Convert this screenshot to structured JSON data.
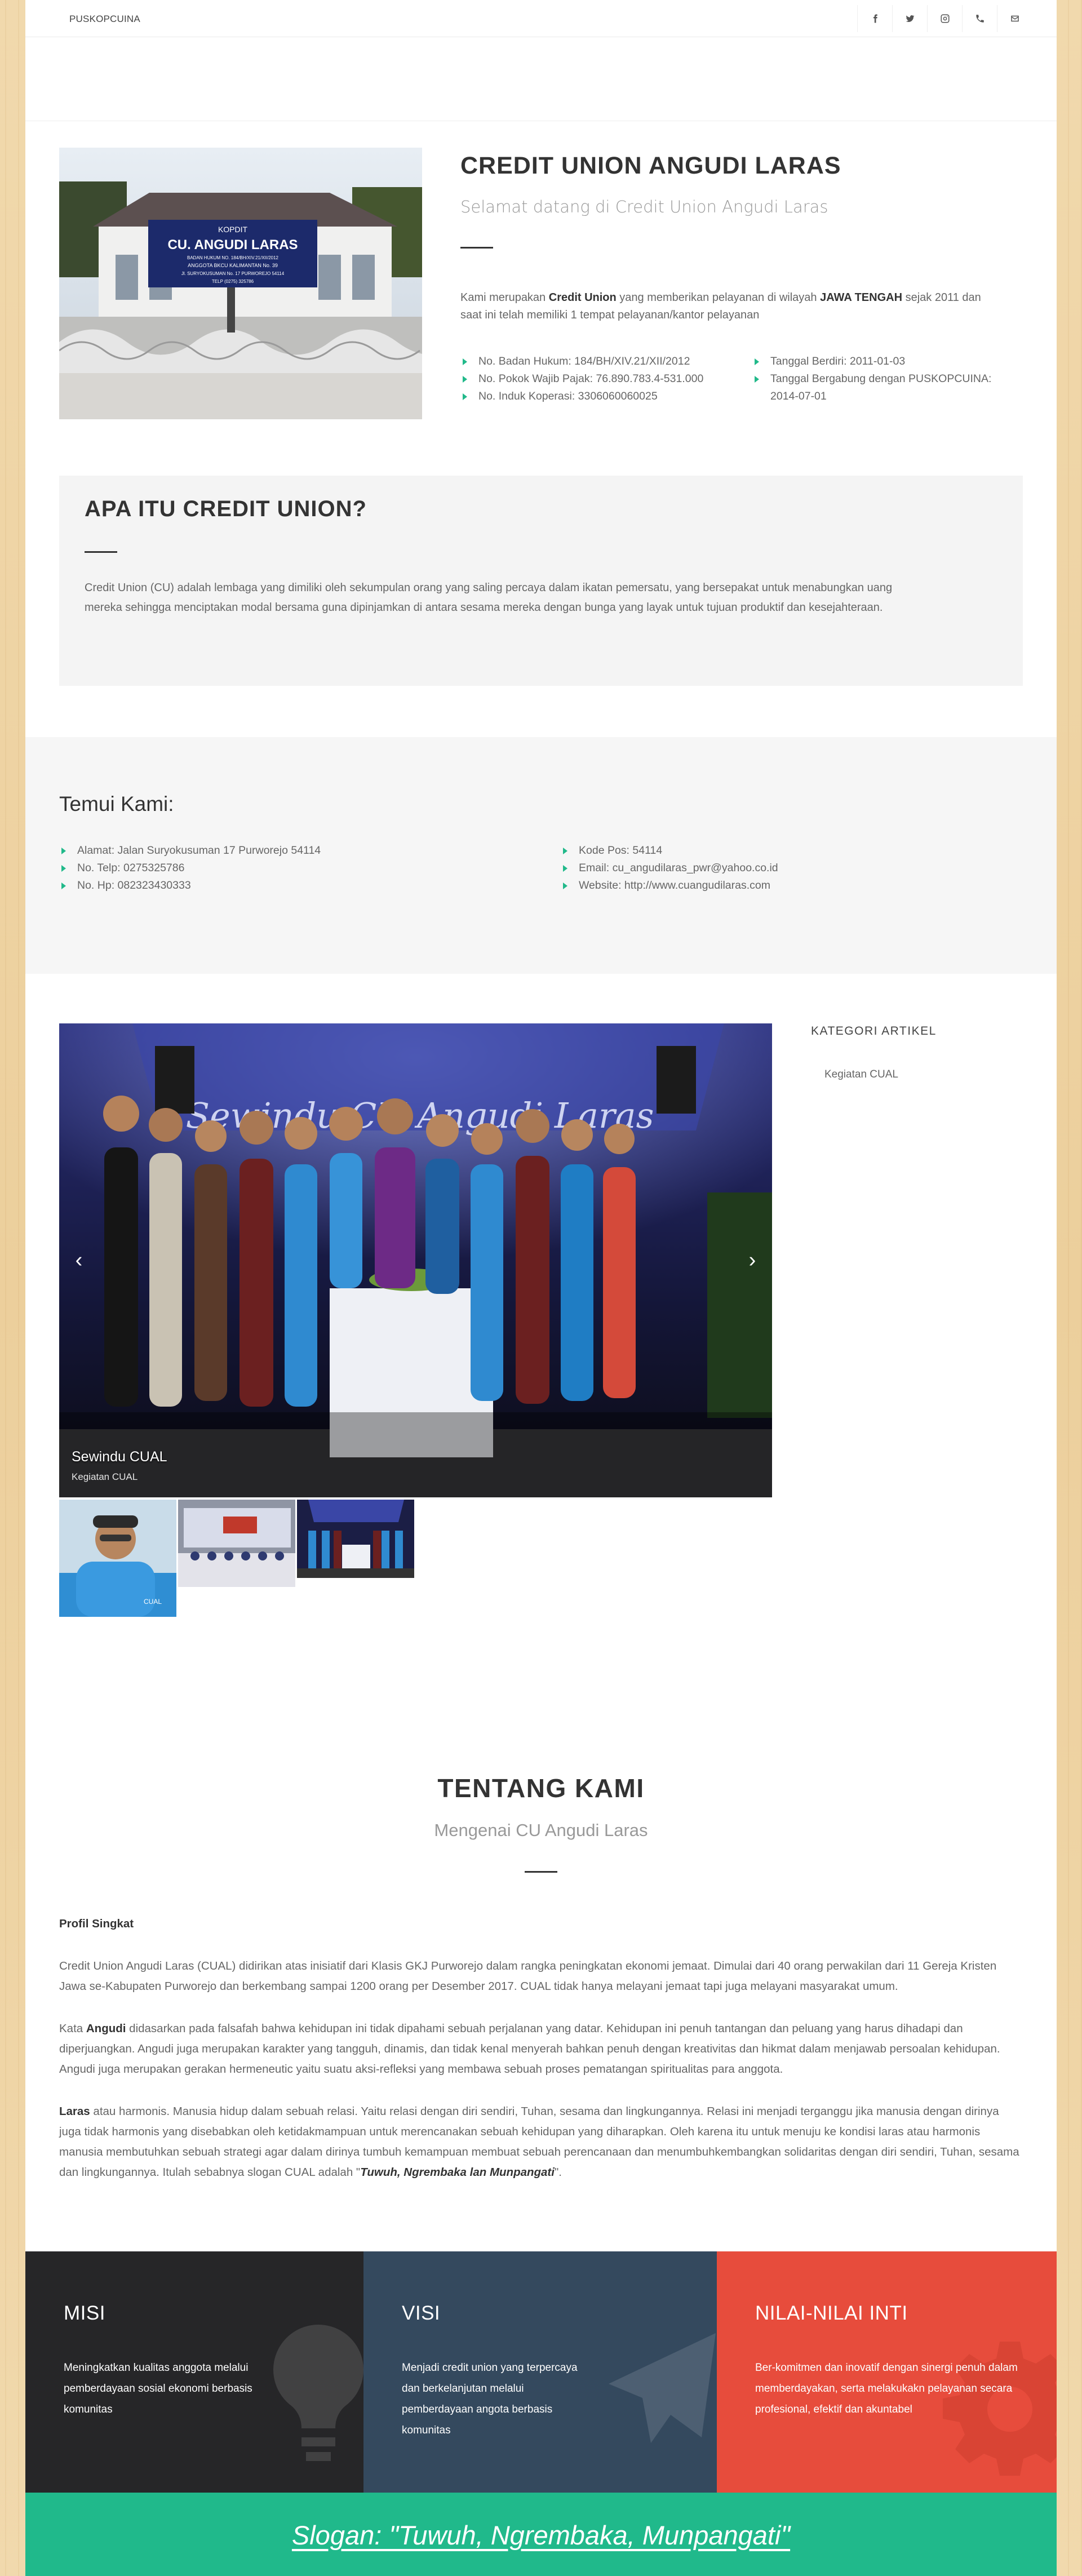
{
  "brand": "PUSKOPCUINA",
  "social": [
    "facebook-icon",
    "twitter-icon",
    "instagram-icon",
    "phone-icon",
    "mail-icon"
  ],
  "intro": {
    "title": "CREDIT UNION ANGUDI LARAS",
    "subtitle": "Selamat datang di Credit Union Angudi Laras",
    "desc_1": "Kami merupakan ",
    "desc_bold_1": "Credit Union",
    "desc_2": " yang memberikan pelayanan di wilayah ",
    "desc_bold_2": "JAWA TENGAH",
    "desc_3": " sejak 2011 dan saat ini telah memiliki 1 tempat pelayanan/kantor pelayanan",
    "left_list": [
      "No. Badan Hukum: 184/BH/XIV.21/XII/2012",
      "No. Pokok Wajib Pajak: 76.890.783.4-531.000",
      "No. Induk Koperasi: 3306060060025"
    ],
    "right_list": [
      "Tanggal Berdiri: 2011-01-03",
      "Tanggal Bergabung dengan PUSKOPCUINA: 2014-07-01"
    ],
    "sign": {
      "line1": "KOPDIT",
      "line2": "CU. ANGUDI LARAS",
      "line3": "BADAN HUKUM NO. 184/BH/XIV.21/XII/2012",
      "line4": "ANGGOTA BKCU KALIMANTAN No. 39",
      "line5": "Jl. SURYOKUSUMAN No. 17 PURWOREJO 54114",
      "line6": "TELP (0275) 325786"
    }
  },
  "what": {
    "title": "APA ITU CREDIT UNION?",
    "text": "Credit Union (CU) adalah lembaga yang dimiliki oleh sekumpulan orang yang saling percaya dalam ikatan pemersatu, yang bersepakat untuk menabungkan uang mereka sehingga menciptakan modal bersama guna dipinjamkan di antara sesama mereka dengan bunga yang layak untuk tujuan produktif dan kesejahteraan."
  },
  "contact": {
    "title": "Temui Kami:",
    "left": [
      "Alamat: Jalan Suryokusuman 17 Purworejo 54114",
      "No. Telp: 0275325786",
      "No. Hp: 082323430333"
    ],
    "right": [
      "Kode Pos: 54114",
      "Email: cu_angudilaras_pwr@yahoo.co.id",
      "Website: http://www.cuangudilaras.com"
    ]
  },
  "slider": {
    "banner": "Sewindu CU Angudi Laras",
    "caption_title": "Sewindu CUAL",
    "caption_sub": "Kegiatan CUAL",
    "prev": "‹",
    "next": "›",
    "thumb_label": "CUAL"
  },
  "sidebar": {
    "title": "KATEGORI ARTIKEL",
    "items": [
      "Kegiatan CUAL"
    ]
  },
  "about": {
    "title": "TENTANG KAMI",
    "subtitle": "Mengenai CU Angudi Laras",
    "profil": "Profil Singkat",
    "p1": "Credit Union Angudi Laras (CUAL) didirikan atas inisiatif dari Klasis GKJ Purworejo dalam rangka peningkatan ekonomi jemaat. Dimulai dari 40 orang perwakilan dari 11 Gereja Kristen Jawa se-Kabupaten Purworejo dan berkembang sampai 1200 orang per Desember 2017. CUAL tidak hanya melayani jemaat tapi juga melayani masyarakat umum.",
    "p2_pre": "Kata ",
    "p2_bold": "Angudi",
    "p2_rest": " didasarkan pada falsafah bahwa kehidupan ini tidak dipahami sebuah perjalanan yang datar. Kehidupan ini penuh tantangan dan peluang yang harus dihadapi dan diperjuangkan. Angudi juga merupakan karakter yang tangguh, dinamis, dan tidak kenal menyerah bahkan penuh dengan kreativitas dan hikmat dalam menjawab persoalan kehidupan. Angudi juga merupakan gerakan hermeneutic yaitu suatu aksi-refleksi yang membawa sebuah proses pematangan spiritualitas para anggota.",
    "p3_bold": "Laras",
    "p3_rest": " atau harmonis. Manusia hidup dalam sebuah relasi. Yaitu relasi dengan diri sendiri, Tuhan, sesama dan lingkungannya. Relasi ini menjadi terganggu jika manusia dengan dirinya juga tidak harmonis yang disebabkan oleh ketidakmampuan untuk merencanakan sebuah kehidupan yang diharapkan. Oleh karena itu untuk menuju ke kondisi laras atau harmonis manusia membutuhkan sebuah strategi agar dalam dirinya tumbuh kemampuan membuat sebuah perencanaan dan menumbuhkembangkan solidaritas dengan diri sendiri, Tuhan, sesama dan lingkungannya. Itulah sebabnya slogan CUAL adalah \"",
    "p3_quote": "Tuwuh, Ngrembaka lan Munpangati",
    "p3_end": "\"."
  },
  "cards": [
    {
      "title": "MISI",
      "text": "Meningkatkan kualitas anggota melalui pemberdayaan sosial ekonomi berbasis komunitas",
      "color": "#262628"
    },
    {
      "title": "VISI",
      "text": "Menjadi credit union yang terpercaya dan berkelanjutan melalui pemberdayaan angota berbasis komunitas",
      "color": "#34495e"
    },
    {
      "title": "NILAI-NILAI INTI",
      "text": "Ber-komitmen dan inovatif dengan sinergi penuh dalam memberdayakan, serta melakukakn pelayanan secara profesional, efektif dan akuntabel",
      "color": "#e74c3c"
    }
  ],
  "slogan": "Slogan: \"Tuwuh, Ngrembaka, Munpangati\"",
  "colors": {
    "accent": "#20b98b",
    "misi": "#262628",
    "visi": "#34495e",
    "nilai": "#e74c3c"
  }
}
